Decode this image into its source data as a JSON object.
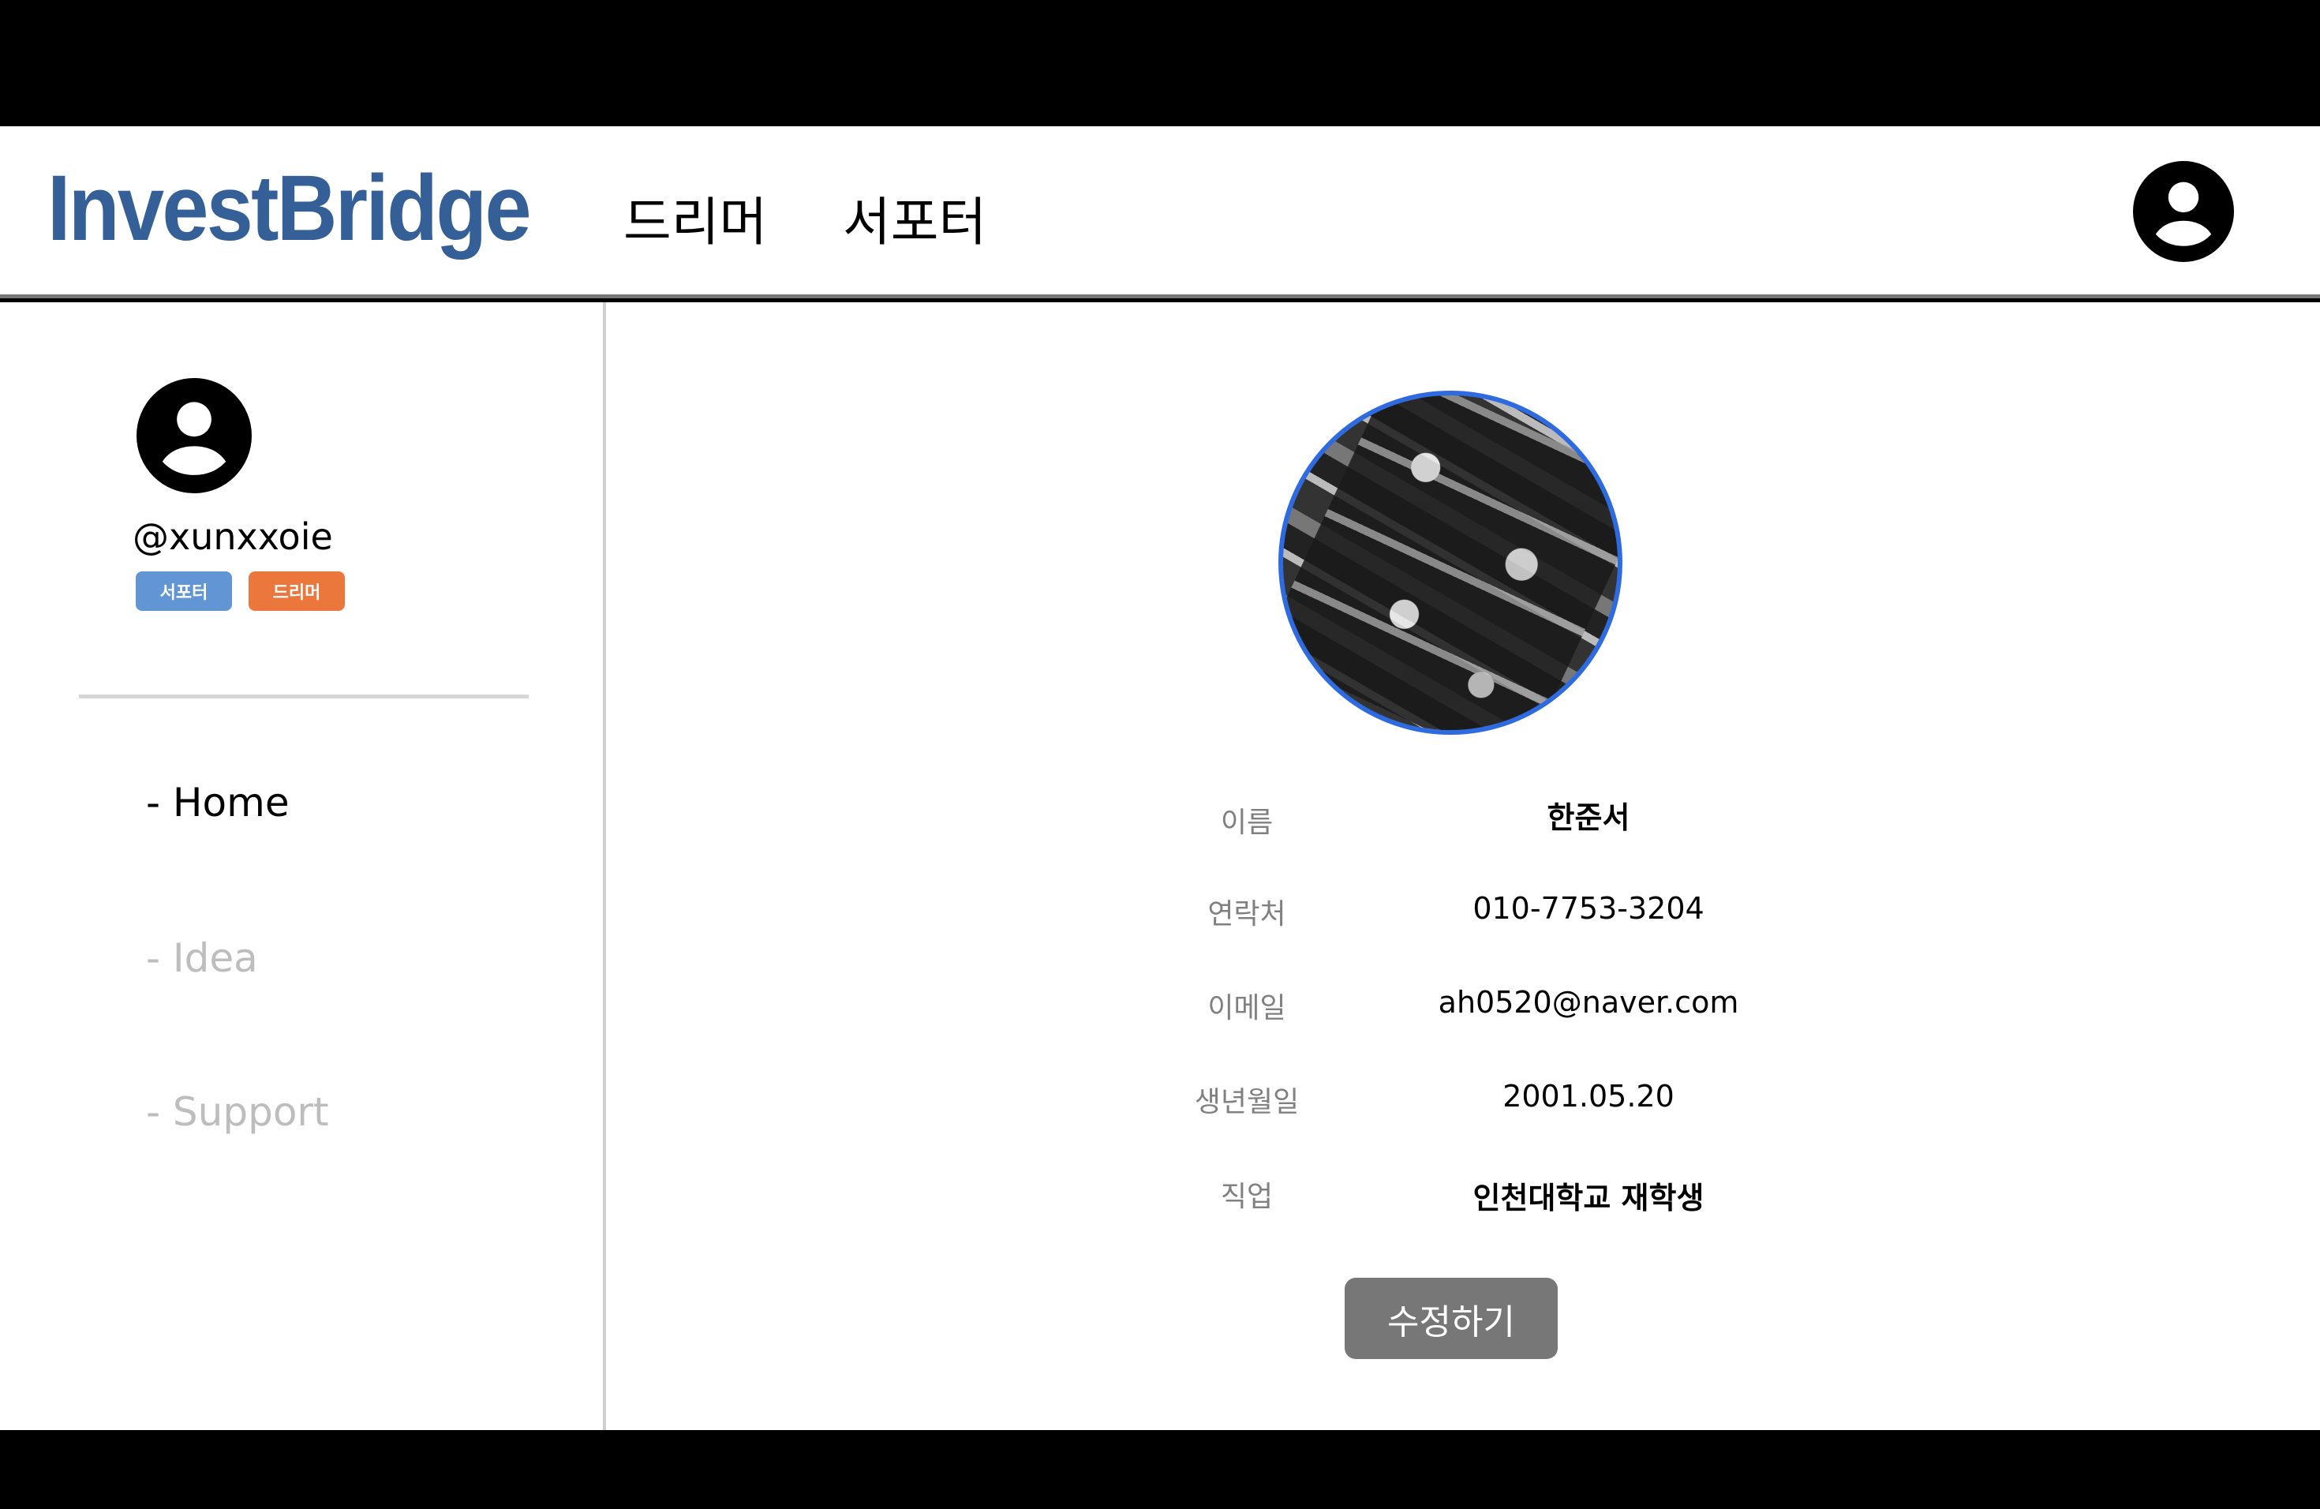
{
  "header": {
    "logo": "InvestBridge",
    "nav": [
      "드리머",
      "서포터"
    ]
  },
  "sidebar": {
    "username": "@xunxxoie",
    "badges": [
      {
        "label": "서포터",
        "color": "#6195d4"
      },
      {
        "label": "드리머",
        "color": "#ec773c"
      }
    ],
    "menu": [
      {
        "label": "- Home",
        "active": true
      },
      {
        "label": "- Idea",
        "active": false
      },
      {
        "label": "- Support",
        "active": false
      }
    ]
  },
  "profile": {
    "rows": [
      {
        "label": "이름",
        "value": "한준서"
      },
      {
        "label": "연락처",
        "value": "010-7753-3204"
      },
      {
        "label": "이메일",
        "value": "ah0520@naver.com"
      },
      {
        "label": "생년월일",
        "value": "2001.05.20"
      },
      {
        "label": "직업",
        "value": "인천대학교 재학생"
      }
    ],
    "edit_label": "수정하기"
  },
  "colors": {
    "brand": "#355f97",
    "photo_border": "#2f6be0",
    "button": "#777777"
  }
}
